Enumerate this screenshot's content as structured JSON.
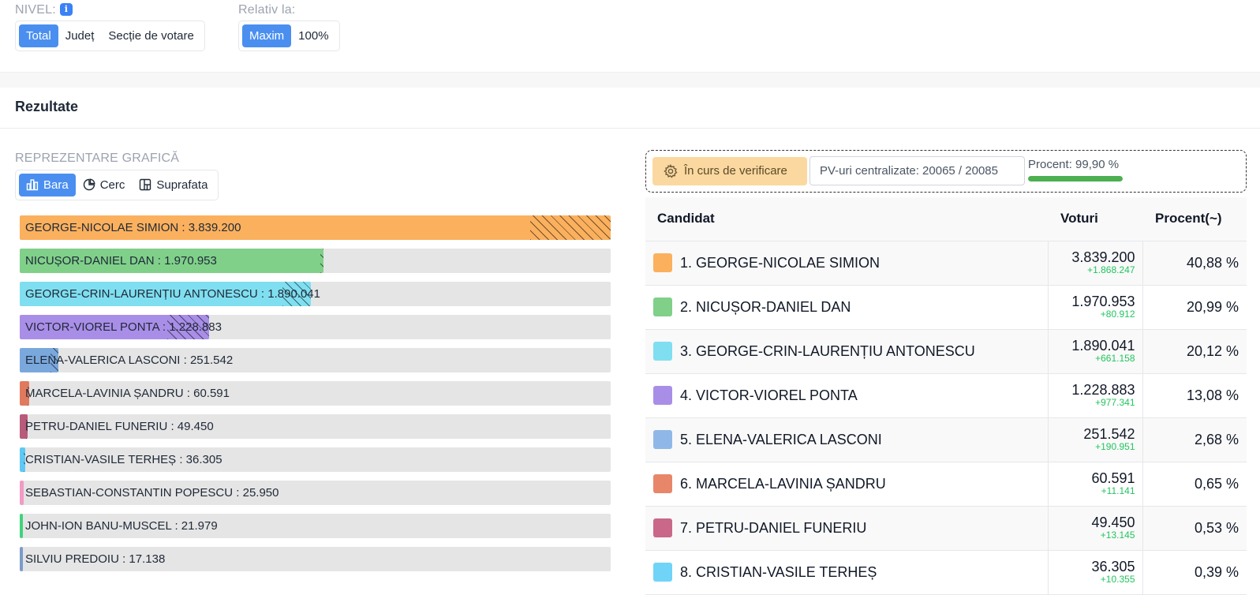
{
  "filters": {
    "nivel_label": "NIVEL:",
    "nivel_info": "i",
    "nivel_options": [
      "Total",
      "Județ",
      "Secție de votare"
    ],
    "relativ_label": "Relativ la:",
    "relativ_options": [
      "Maxim",
      "100%"
    ]
  },
  "results": {
    "title": "Rezultate",
    "graph_label": "REPREZENTARE GRAFICĂ",
    "graph_options": [
      "Bara",
      "Cerc",
      "Suprafata"
    ]
  },
  "status": {
    "verification": "În curs de verificare",
    "pv": "PV-uri centralizate: 20065 / 20085",
    "percent_label": "Procent: 99,90 %",
    "percent_value": 99.9,
    "progress_color": "#4caf50"
  },
  "table": {
    "headers": [
      "Candidat",
      "Voturi",
      "Procent(~)"
    ],
    "rows": [
      {
        "name": "1. GEORGE-NICOLAE SIMION",
        "votes": "3.839.200",
        "delta": "+1.868.247",
        "pct": "40,88 %",
        "color": "#fbb05e"
      },
      {
        "name": "2. NICUȘOR-DANIEL DAN",
        "votes": "1.970.953",
        "delta": "+80.912",
        "pct": "20,99 %",
        "color": "#80d08a"
      },
      {
        "name": "3. GEORGE-CRIN-LAURENȚIU ANTONESCU",
        "votes": "1.890.041",
        "delta": "+661.158",
        "pct": "20,12 %",
        "color": "#7fdff0"
      },
      {
        "name": "4. VICTOR-VIOREL PONTA",
        "votes": "1.228.883",
        "delta": "+977.341",
        "pct": "13,08 %",
        "color": "#a98ee8"
      },
      {
        "name": "5. ELENA-VALERICA LASCONI",
        "votes": "251.542",
        "delta": "+190.951",
        "pct": "2,68 %",
        "color": "#8fb8e8"
      },
      {
        "name": "6. MARCELA-LAVINIA ȘANDRU",
        "votes": "60.591",
        "delta": "+11.141",
        "pct": "0,65 %",
        "color": "#e8866a"
      },
      {
        "name": "7. PETRU-DANIEL FUNERIU",
        "votes": "49.450",
        "delta": "+13.145",
        "pct": "0,53 %",
        "color": "#c96888"
      },
      {
        "name": "8. CRISTIAN-VASILE TERHEȘ",
        "votes": "36.305",
        "delta": "+10.355",
        "pct": "0,39 %",
        "color": "#6fd4f8"
      }
    ]
  },
  "bars": [
    {
      "label": "GEORGE-NICOLAE SIMION : 3.839.200",
      "value": 3839200,
      "delta": 1868247,
      "color": "#fbb05e"
    },
    {
      "label": "NICUȘOR-DANIEL DAN : 1.970.953",
      "value": 1970953,
      "delta": 80912,
      "color": "#80d08a"
    },
    {
      "label": "GEORGE-CRIN-LAURENȚIU ANTONESCU : 1.890.041",
      "value": 1890041,
      "delta": 661158,
      "color": "#7fdff0"
    },
    {
      "label": "VICTOR-VIOREL PONTA : 1.228.883",
      "value": 1228883,
      "delta": 977341,
      "color": "#a98ee8"
    },
    {
      "label": "ELENA-VALERICA LASCONI : 251.542",
      "value": 251542,
      "delta": 190951,
      "color": "#7aa8dd"
    },
    {
      "label": "MARCELA-LAVINIA ȘANDRU : 60.591",
      "value": 60591,
      "delta": 11141,
      "color": "#e07a5f"
    },
    {
      "label": "PETRU-DANIEL FUNERIU : 49.450",
      "value": 49450,
      "delta": 13145,
      "color": "#b85a7a"
    },
    {
      "label": "CRISTIAN-VASILE TERHEȘ : 36.305",
      "value": 36305,
      "delta": 10355,
      "color": "#5ec8f5"
    },
    {
      "label": "SEBASTIAN-CONSTANTIN POPESCU : 25.950",
      "value": 25950,
      "delta": 0,
      "color": "#f29bc4"
    },
    {
      "label": "JOHN-ION BANU-MUSCEL : 21.979",
      "value": 21979,
      "delta": 0,
      "color": "#3ed47e"
    },
    {
      "label": "SILVIU PREDOIU : 17.138",
      "value": 17138,
      "delta": 0,
      "color": "#7a9cc8"
    }
  ]
}
